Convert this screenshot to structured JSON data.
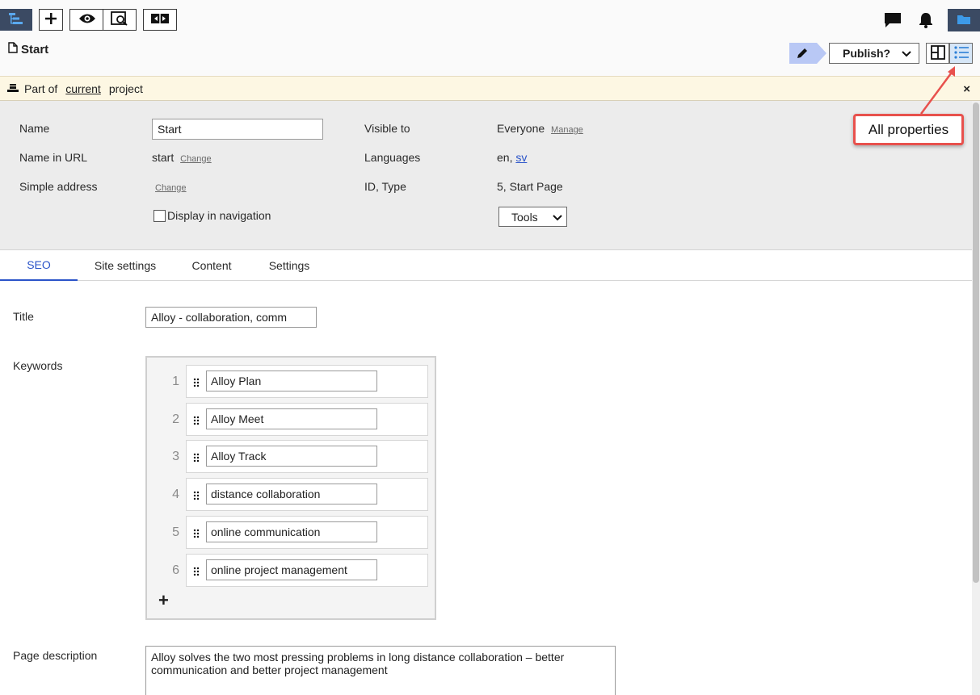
{
  "toolbar": {
    "icons": [
      "tree-icon",
      "plus-icon",
      "eye-icon",
      "preview-icon",
      "compare-icon",
      "chat-icon",
      "bell-icon",
      "folder-icon"
    ]
  },
  "page": {
    "title": "Start",
    "publish_label": "Publish?"
  },
  "project_bar": {
    "prefix": "Part of",
    "link": "current",
    "suffix": "project",
    "close": "×"
  },
  "header": {
    "name_label": "Name",
    "name_value": "Start",
    "url_label": "Name in URL",
    "url_value": "start",
    "url_change": "Change",
    "simple_label": "Simple address",
    "simple_change": "Change",
    "display_nav_label": "Display in navigation",
    "visible_label": "Visible to",
    "visible_value": "Everyone",
    "visible_manage": "Manage",
    "languages_label": "Languages",
    "languages_prefix": "en,",
    "languages_link": "sv",
    "id_label": "ID, Type",
    "id_value": "5, Start Page",
    "tools_label": "Tools"
  },
  "callout": {
    "text": "All properties"
  },
  "tabs": [
    {
      "label": "SEO",
      "active": true
    },
    {
      "label": "Site settings",
      "active": false
    },
    {
      "label": "Content",
      "active": false
    },
    {
      "label": "Settings",
      "active": false
    }
  ],
  "seo": {
    "title_label": "Title",
    "title_value": "Alloy - collaboration, comm",
    "keywords_label": "Keywords",
    "keywords": [
      {
        "num": "1",
        "value": "Alloy Plan"
      },
      {
        "num": "2",
        "value": "Alloy Meet"
      },
      {
        "num": "3",
        "value": "Alloy Track"
      },
      {
        "num": "4",
        "value": "distance collaboration"
      },
      {
        "num": "5",
        "value": "online communication"
      },
      {
        "num": "6",
        "value": "online project management"
      }
    ],
    "add_keyword": "+",
    "description_label": "Page description",
    "description_value": "Alloy solves the two most pressing problems in long distance collaboration – better communication and better project management"
  },
  "colors": {
    "accent": "#2b54c9",
    "callout_border": "#e8514d",
    "project_bar_bg": "#fdf7e3",
    "header_bg": "#ececec"
  }
}
